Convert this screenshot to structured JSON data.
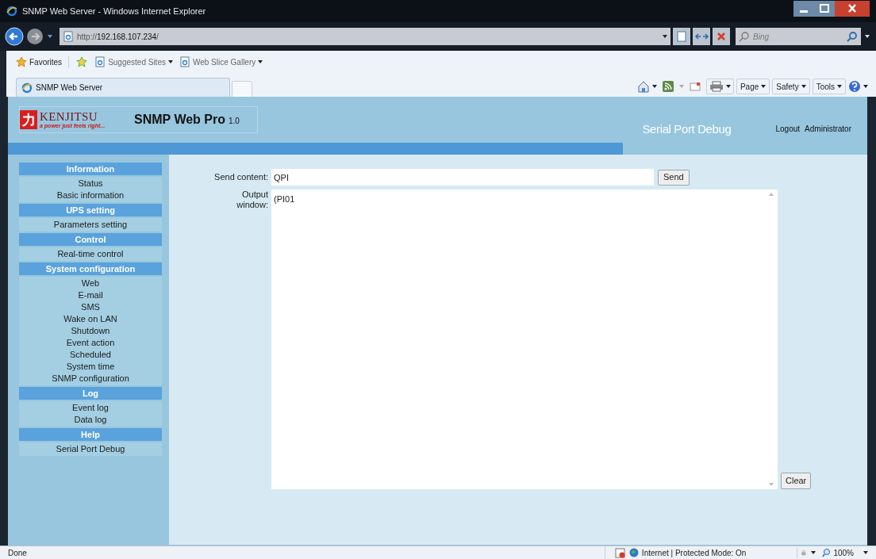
{
  "window": {
    "title": "SNMP Web Server - Windows Internet Explorer"
  },
  "address_bar": {
    "url_prefix": "http://",
    "url_host": "192.168.107.234",
    "url_suffix": "/"
  },
  "search": {
    "placeholder": "Bing"
  },
  "favorites_bar": {
    "favorites": "Favorites",
    "links": [
      "Suggested Sites",
      "Web Slice Gallery"
    ]
  },
  "tab": {
    "title": "SNMP Web Server"
  },
  "command_bar": {
    "menus": [
      "Page",
      "Safety",
      "Tools"
    ]
  },
  "header": {
    "logo_mark": "力",
    "brand": "KENJITSU",
    "tagline": "a power just feels right...",
    "product": "SNMP Web Pro",
    "version": "1.0",
    "page_title": "Serial Port Debug",
    "links": [
      "Logout",
      "Administrator"
    ]
  },
  "sidebar": {
    "sections": [
      {
        "title": "Information",
        "items": [
          "Status",
          "Basic information"
        ]
      },
      {
        "title": "UPS setting",
        "items": [
          "Parameters setting"
        ]
      },
      {
        "title": "Control",
        "items": [
          "Real-time control"
        ]
      },
      {
        "title": "System configuration",
        "items": [
          "Web",
          "E-mail",
          "SMS",
          "Wake on LAN",
          "Shutdown",
          "Event action",
          "Scheduled",
          "System time",
          "SNMP configuration"
        ]
      },
      {
        "title": "Log",
        "items": [
          "Event log",
          "Data log"
        ]
      },
      {
        "title": "Help",
        "items": [
          "Serial Port Debug"
        ]
      }
    ]
  },
  "form": {
    "send_label": "Send content:",
    "send_value": "QPI",
    "send_button": "Send",
    "output_label": "Output window:",
    "output_text": "(PI01",
    "clear_button": "Clear"
  },
  "status_bar": {
    "status": "Done",
    "zone": "Internet | Protected Mode: On",
    "zoom": "100%"
  }
}
